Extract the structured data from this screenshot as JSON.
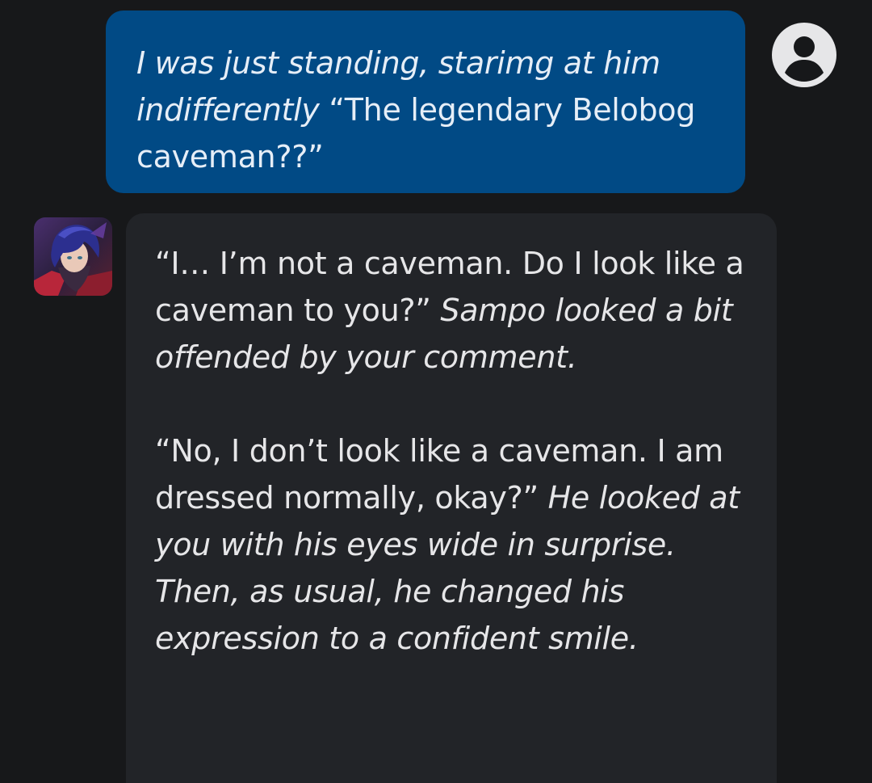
{
  "user_message": {
    "italic": "I was just standing, starimg at him indifferently",
    "plain": " “The legendary Belobog caveman??”"
  },
  "bot_message": {
    "paragraph_1": {
      "plain": "“I… I’m not a caveman. Do I look like a caveman to you?” ",
      "italic": "Sampo looked a bit offended by your comment."
    },
    "paragraph_2": {
      "plain": "“No, I don’t look like a caveman. I am dressed normally, okay?” ",
      "italic": "He looked at you with his eyes wide in surprise. Then, as usual, he changed his expression to a confident smile."
    }
  },
  "icons": {
    "user_avatar": "account-circle-icon",
    "bot_avatar": "character-portrait"
  },
  "colors": {
    "background": "#17181a",
    "user_bubble": "#014a85",
    "bot_bubble": "#222428",
    "text": "#e6e6e8"
  }
}
